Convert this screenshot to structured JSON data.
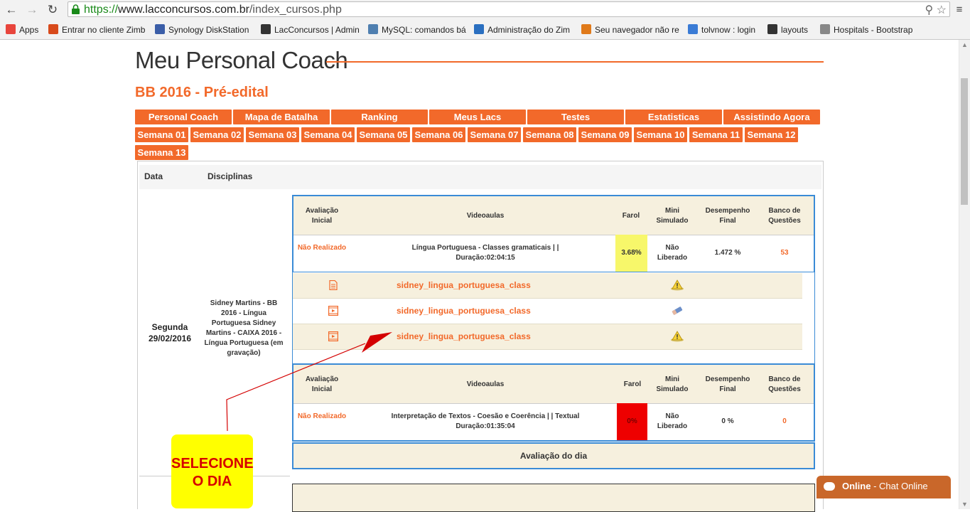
{
  "browser": {
    "url_scheme": "https://",
    "url_host": "www.lacconcursos.com.br",
    "url_path": "/index_cursos.php",
    "bookmarks": [
      {
        "label": "Apps",
        "icon": "apps-grid-icon",
        "color": "#e8453c"
      },
      {
        "label": "Entrar no cliente Zimb",
        "icon": "zimbra-icon",
        "color": "#d84a1b"
      },
      {
        "label": "Synology DiskStation",
        "icon": "synology-icon",
        "color": "#3b5ea8"
      },
      {
        "label": "LacConcursos | Admin",
        "icon": "lac-icon",
        "color": "#333333"
      },
      {
        "label": "MySQL: comandos bá",
        "icon": "mysql-icon",
        "color": "#4f7fb0"
      },
      {
        "label": "Administração do Zim",
        "icon": "zimbra-z-icon",
        "color": "#2a6fc0"
      },
      {
        "label": "Seu navegador não re",
        "icon": "tt-icon",
        "color": "#e07a1a"
      },
      {
        "label": "tolvnow : login",
        "icon": "tolvnow-icon",
        "color": "#3a7bd5"
      },
      {
        "label": "layouts",
        "icon": "w3-icon",
        "color": "#333333"
      },
      {
        "label": "Hospitals - Bootstrap",
        "icon": "page-icon",
        "color": "#888888"
      }
    ]
  },
  "page": {
    "title": "Meu Personal Coach",
    "course": "BB 2016 - Pré-edital",
    "accent": "#f2692a",
    "main_tabs": [
      "Personal Coach",
      "Mapa de Batalha",
      "Ranking",
      "Meus Lacs",
      "Testes",
      "Estatisticas",
      "Assistindo Agora"
    ],
    "week_tabs": [
      "Semana 01",
      "Semana 02",
      "Semana 03",
      "Semana 04",
      "Semana 05",
      "Semana 06",
      "Semana 07",
      "Semana 08",
      "Semana 09",
      "Semana 10",
      "Semana 11",
      "Semana 12",
      "Semana 13"
    ],
    "schedule_headers": {
      "data": "Data",
      "disciplinas": "Disciplinas"
    },
    "day": {
      "weekday": "Segunda",
      "date": "29/02/2016"
    },
    "disciplines": "Sidney Martins - BB 2016 - Língua Portuguesa Sidney Martins - CAIXA 2016 - Língua Portuguesa (em gravação)"
  },
  "lesson_headers": {
    "avaliacao_inicial": "Avaliação Inicial",
    "videoaulas": "Videoaulas",
    "farol": "Farol",
    "mini_simulado": "Mini Simulado",
    "desempenho_final": "Desempenho Final",
    "banco_questoes": "Banco de Questões"
  },
  "lessons": [
    {
      "avaliacao": "Não Realizado",
      "title": "Língua Portuguesa - Classes gramaticais | |",
      "duration": "Duração:02:04:15",
      "farol": "3.68%",
      "farol_color": "#f7f76a",
      "mini_simulado": "Não Liberado",
      "desempenho": "1.472 %",
      "banco": "53"
    },
    {
      "avaliacao": "Não Realizado",
      "title": "Interpretação de Textos - Coesão e Coerência | | Textual",
      "duration": "Duração:01:35:04",
      "farol": "0%",
      "farol_color": "#ee0000",
      "mini_simulado": "Não Liberado",
      "desempenho": "0 %",
      "banco": "0"
    }
  ],
  "materials": [
    {
      "type_icon": "document-icon",
      "label": "sidney_lingua_portuguesa_class",
      "status_icon": "warning-icon"
    },
    {
      "type_icon": "video-icon",
      "label": "sidney_lingua_portuguesa_class",
      "status_icon": "pencil-eraser-icon"
    },
    {
      "type_icon": "video-icon",
      "label": "sidney_lingua_portuguesa_class",
      "status_icon": "warning-icon"
    }
  ],
  "avaliacao_dia": "Avaliação do dia",
  "callout": "SELECIONE O DIA",
  "chat": {
    "status": "Online",
    "label": " - Chat Online"
  }
}
